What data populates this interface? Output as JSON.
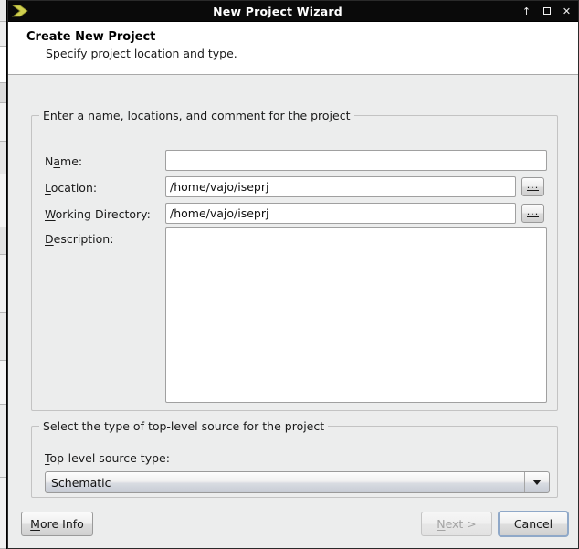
{
  "window": {
    "title": "New Project Wizard",
    "app_icon": "chevron-right-icon",
    "accent_icon_color": "#cfcf4f",
    "titlebar_bg": "#0a0a0a",
    "dialog_bg": "#eceded",
    "controls": [
      {
        "name": "shade-button",
        "glyph": "↑"
      },
      {
        "name": "maximize-button",
        "glyph": "□"
      },
      {
        "name": "close-button",
        "glyph": "✕"
      }
    ]
  },
  "header": {
    "title": "Create New Project",
    "subtitle": "Specify project location and type."
  },
  "project_group": {
    "legend": "Enter a name, locations, and comment for the project",
    "fields": [
      {
        "label_pre": "N",
        "label_mn": "a",
        "label_post": "me:",
        "label_full": "Name:",
        "value": "",
        "placeholder": "",
        "has_browse": false
      },
      {
        "label_pre": "",
        "label_mn": "L",
        "label_post": "ocation:",
        "label_full": "Location:",
        "value": "/home/vajo/iseprj",
        "placeholder": "",
        "has_browse": true
      },
      {
        "label_pre": "",
        "label_mn": "W",
        "label_post": "orking Directory:",
        "label_full": "Working Directory:",
        "value": "/home/vajo/iseprj",
        "placeholder": "",
        "has_browse": true
      }
    ],
    "description": {
      "label_pre": "",
      "label_mn": "D",
      "label_post": "escription:",
      "label_full": "Description:",
      "value": "",
      "placeholder": ""
    },
    "browse_button_label": "..."
  },
  "source_group": {
    "legend": "Select the type of top-level source for the project",
    "field_label_pre": "",
    "field_label_mn": "T",
    "field_label_post": "op-level source type:",
    "field_label_full": "Top-level source type:",
    "selected": "Schematic",
    "options": [
      "Schematic"
    ]
  },
  "footer": {
    "more_info": {
      "pre": "",
      "mn": "M",
      "post": "ore Info",
      "full": "More Info",
      "enabled": true
    },
    "next": {
      "pre": "",
      "mn": "N",
      "post": "ext >",
      "full": "Next >",
      "enabled": false
    },
    "cancel": {
      "pre": "Cancel",
      "mn": "",
      "post": "",
      "full": "Cancel",
      "enabled": true,
      "focused": true
    }
  }
}
